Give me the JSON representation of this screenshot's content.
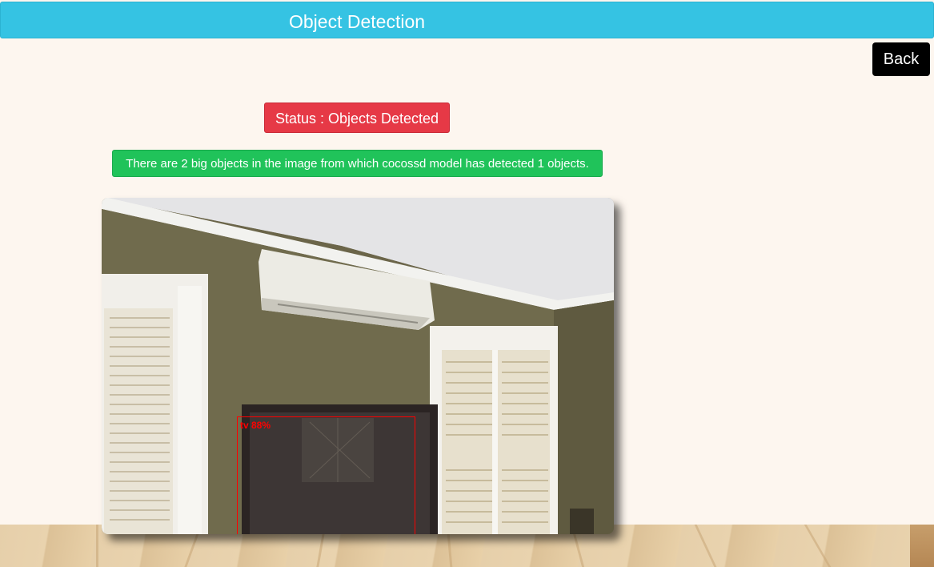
{
  "header": {
    "title": "Object Detection"
  },
  "toolbar": {
    "back_label": "Back"
  },
  "status": {
    "text": "Status : Objects Detected",
    "color": "#e63946"
  },
  "info": {
    "message": "There are 2 big objects in the image from which cocossd model has detected 1 objects.",
    "color": "#20c35a"
  },
  "detection": {
    "label": "tv 88%",
    "box_color": "#ff0000"
  },
  "colors": {
    "header": "#35c3e3",
    "background": "#fdf6ef"
  }
}
